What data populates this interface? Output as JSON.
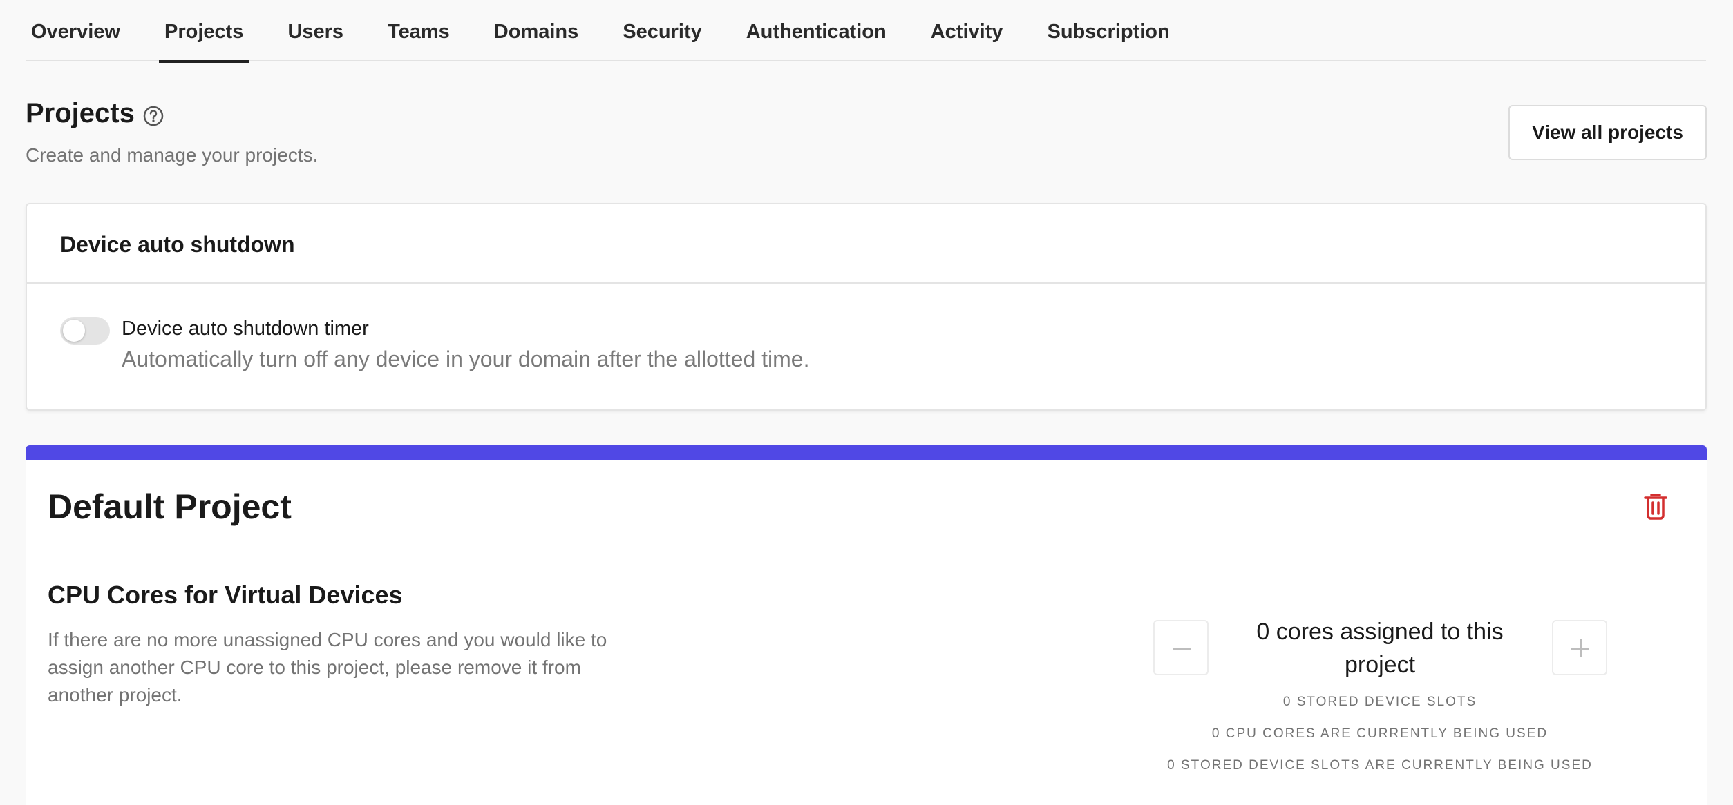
{
  "tabs": [
    {
      "label": "Overview",
      "active": false
    },
    {
      "label": "Projects",
      "active": true
    },
    {
      "label": "Users",
      "active": false
    },
    {
      "label": "Teams",
      "active": false
    },
    {
      "label": "Domains",
      "active": false
    },
    {
      "label": "Security",
      "active": false
    },
    {
      "label": "Authentication",
      "active": false
    },
    {
      "label": "Activity",
      "active": false
    },
    {
      "label": "Subscription",
      "active": false
    }
  ],
  "header": {
    "title": "Projects",
    "help_icon": "question-circle-icon",
    "subtitle": "Create and manage your projects.",
    "view_all_label": "View all projects"
  },
  "auto_shutdown": {
    "card_title": "Device auto shutdown",
    "toggle_on": false,
    "timer_label": "Device auto shutdown timer",
    "timer_description": "Automatically turn off any device in your domain after the allotted time."
  },
  "project": {
    "accent_color": "#5048e5",
    "name": "Default Project",
    "delete_icon": "trash-icon",
    "delete_color": "#d32f2f",
    "cpu_title": "CPU Cores for Virtual Devices",
    "cpu_description": "If there are no more unassigned CPU cores and you would like to assign another CPU core to this project, please remove it from another project.",
    "cores_assigned_text": "0 cores assigned to this project",
    "stats": [
      "0 STORED DEVICE SLOTS",
      "0 CPU CORES ARE CURRENTLY BEING USED",
      "0 STORED DEVICE SLOTS ARE CURRENTLY BEING USED"
    ]
  }
}
